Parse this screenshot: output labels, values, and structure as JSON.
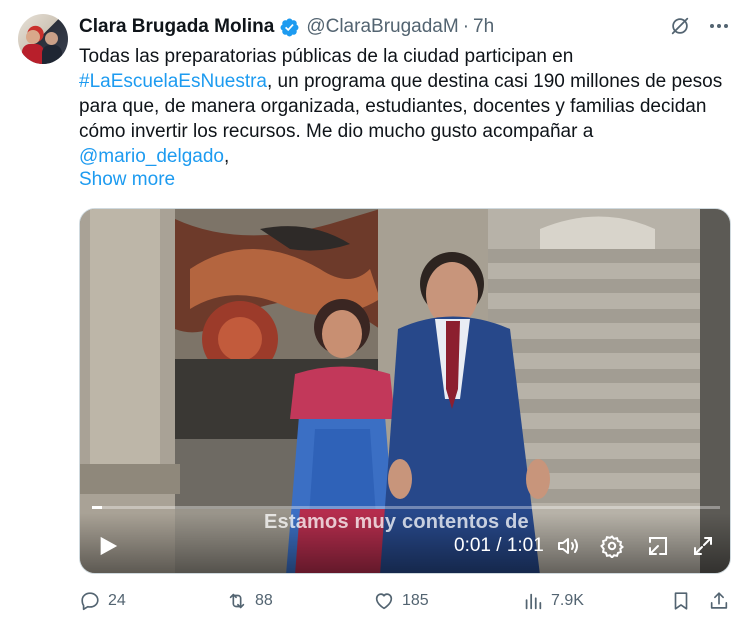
{
  "post": {
    "author_name": "Clara Brugada Molina",
    "handle": "@ClaraBrugadaM",
    "separator": "·",
    "time": "7h",
    "text_line1": "Todas las preparatorias públicas de la ciudad participan en",
    "hashtag": "#LaEscuelaEsNuestra",
    "text_line2_rest": ", un programa que destina casi 190 millones de pesos",
    "text_line3": "para que, de manera organizada, estudiantes, docentes y familias decidan",
    "text_line4": "cómo invertir los recursos. Me dio mucho gusto acompañar a",
    "mention": "@mario_delgado",
    "mention_trailing": ",",
    "show_more": "Show more"
  },
  "video": {
    "caption": "Estamos muy contentos de",
    "time_display": "0:01 / 1:01",
    "progress_fraction": 0.016
  },
  "actions": {
    "replies": "24",
    "reposts": "88",
    "likes": "185",
    "views": "7.9K"
  },
  "icons": {
    "verified": "verified-badge-icon",
    "grok": "grok-icon",
    "more": "more-icon",
    "play": "play-icon",
    "volume": "volume-icon",
    "settings": "settings-icon",
    "pip": "picture-in-picture-icon",
    "fullscreen": "fullscreen-icon",
    "reply": "reply-icon",
    "retweet": "retweet-icon",
    "like": "like-icon",
    "views": "views-icon",
    "bookmark": "bookmark-icon",
    "share": "share-icon"
  },
  "colors": {
    "link": "#1d9bf0",
    "secondary_text": "#536471",
    "verified": "#1d9bf0"
  }
}
